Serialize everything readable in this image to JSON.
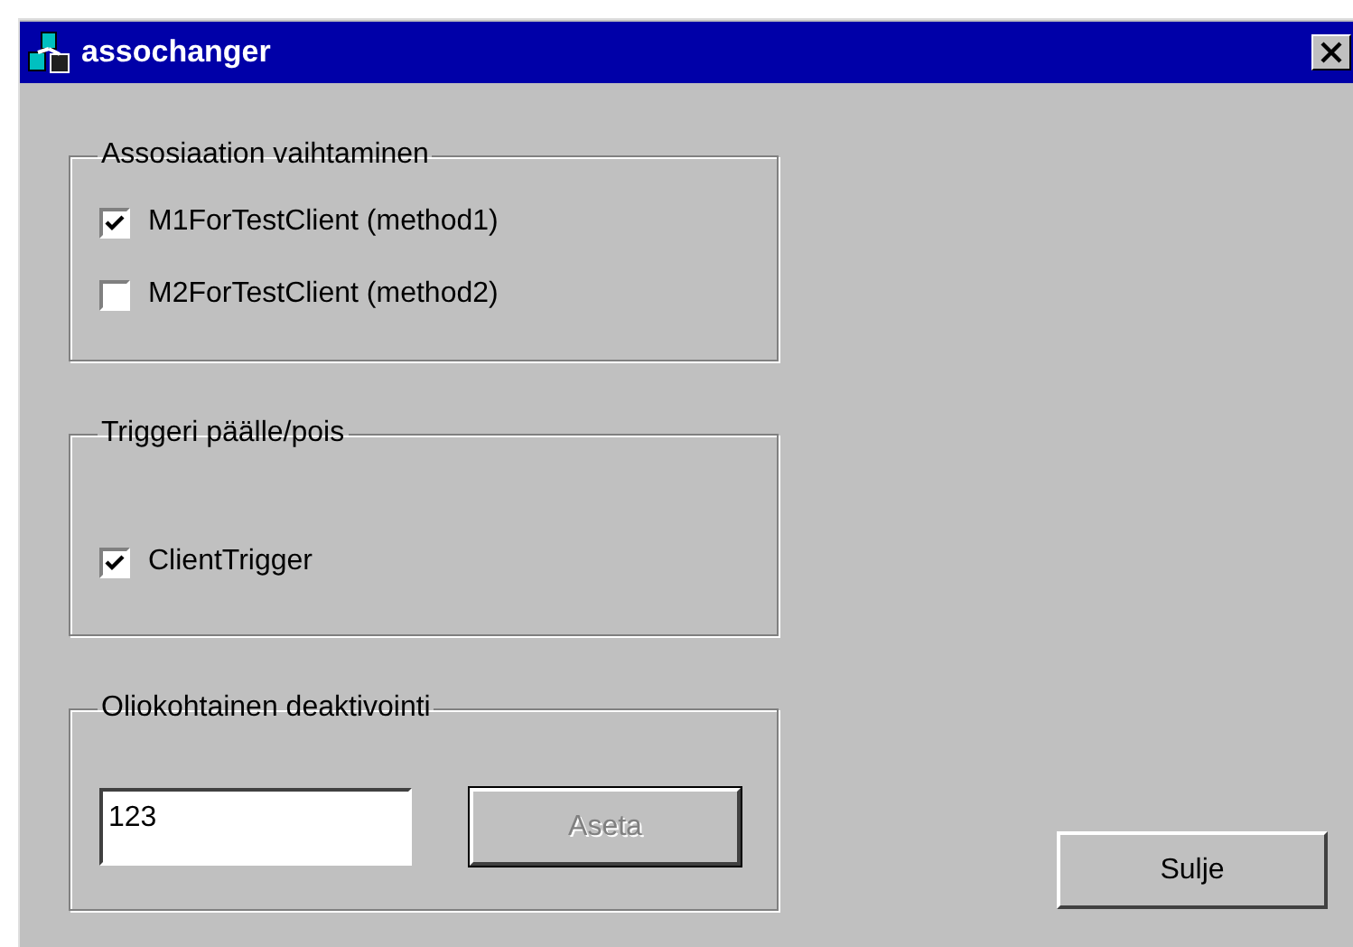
{
  "window": {
    "title": "assochanger"
  },
  "groups": [
    {
      "title": "Assosiaation vaihtaminen",
      "items": [
        {
          "label": "M1ForTestClient (method1)",
          "checked": true
        },
        {
          "label": "M2ForTestClient (method2)",
          "checked": false
        }
      ]
    },
    {
      "title": "Triggeri päälle/pois",
      "items": [
        {
          "label": "ClientTrigger",
          "checked": true
        }
      ]
    }
  ],
  "deactivation": {
    "title": "Oliokohtainen deaktivointi",
    "value": "123",
    "button": {
      "label": "Aseta",
      "disabled": true
    }
  },
  "close_button": {
    "label": "Sulje",
    "disabled": false
  }
}
